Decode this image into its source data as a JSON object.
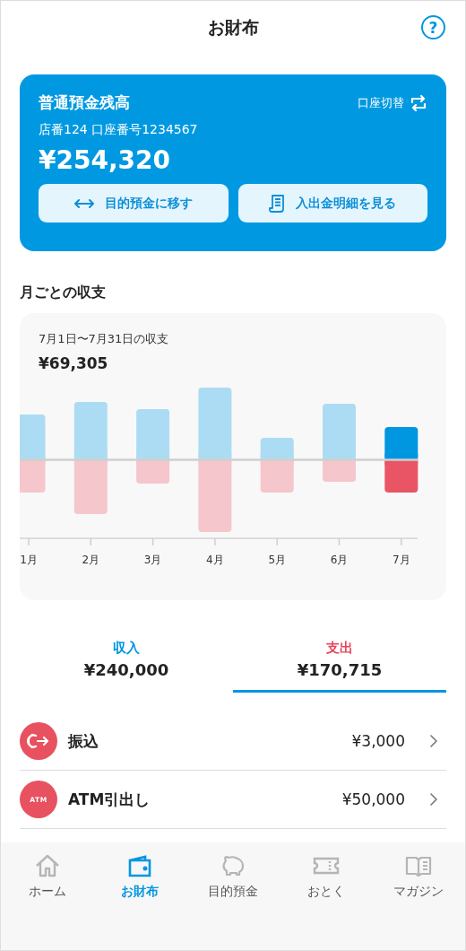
{
  "header": {
    "title": "お財布",
    "help": "?"
  },
  "account": {
    "title": "普通預金残高",
    "switch_label": "口座切替",
    "number": "店番124 口座番号1234567",
    "balance": "¥254,320",
    "actions": [
      {
        "kind": "transfer",
        "label": "目的預金に移す"
      },
      {
        "kind": "statement",
        "label": "入出金明細を見る"
      }
    ]
  },
  "monthly": {
    "title": "月ごとの収支",
    "period": "7月1日〜7月31日の収支",
    "net": "¥69,305",
    "months": [
      {
        "label": "1月",
        "selected": false
      },
      {
        "label": "2月",
        "selected": false
      },
      {
        "label": "3月",
        "selected": false
      },
      {
        "label": "4月",
        "selected": false
      },
      {
        "label": "5月",
        "selected": false
      },
      {
        "label": "6月",
        "selected": false
      },
      {
        "label": "7月",
        "selected": true
      }
    ]
  },
  "tabs": [
    {
      "label": "収入",
      "amount": "¥240,000",
      "color": "#0096e0",
      "selected": false
    },
    {
      "label": "支出",
      "amount": "¥170,715",
      "color": "#e8445a",
      "selected": true
    }
  ],
  "transactions": [
    {
      "kind": "transfer",
      "name": "振込",
      "amount": "¥3,000"
    },
    {
      "kind": "atm",
      "icon_text": "ATM",
      "name": "ATM引出し",
      "amount": "¥50,000"
    }
  ],
  "nav": [
    {
      "kind": "home",
      "label": "ホーム",
      "selected": false
    },
    {
      "kind": "wallet",
      "label": "お財布",
      "selected": true
    },
    {
      "kind": "piggy",
      "label": "目的預金",
      "selected": false
    },
    {
      "kind": "ticket",
      "label": "おとく",
      "selected": false
    },
    {
      "kind": "book",
      "label": "マガジン",
      "selected": false
    }
  ]
}
